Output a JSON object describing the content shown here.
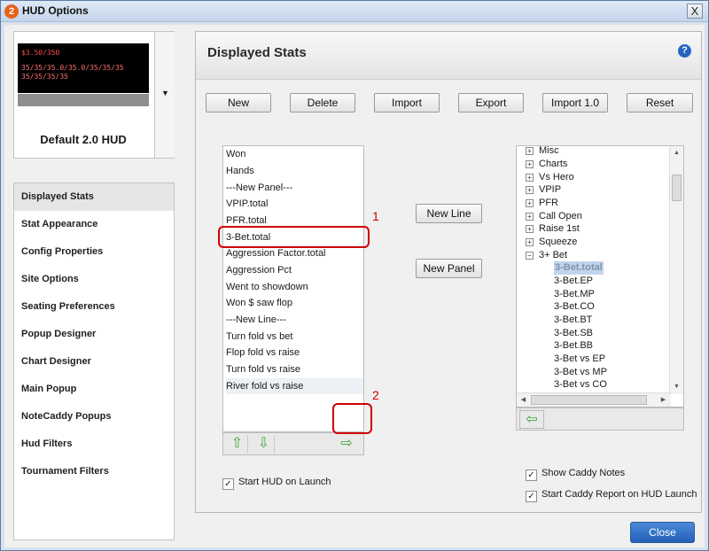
{
  "window": {
    "title": "HUD Options",
    "app_icon": "2",
    "close_glyph": "X"
  },
  "hud_preview": {
    "name": "Default 2.0 HUD",
    "line1": "$3.50/350",
    "line2": "35/35/35.0/35.0/35/35/35",
    "line3": "35/35/35/35",
    "dropdown_icon": "chevron-down-icon"
  },
  "sidebar": {
    "items": [
      {
        "label": "Displayed Stats",
        "active": true
      },
      {
        "label": "Stat Appearance"
      },
      {
        "label": "Config Properties"
      },
      {
        "label": "Site Options"
      },
      {
        "label": "Seating Preferences"
      },
      {
        "label": "Popup Designer"
      },
      {
        "label": "Chart Designer"
      },
      {
        "label": "Main Popup"
      },
      {
        "label": "NoteCaddy Popups"
      },
      {
        "label": "Hud Filters"
      },
      {
        "label": "Tournament Filters"
      }
    ]
  },
  "panel": {
    "title": "Displayed Stats",
    "help": "?"
  },
  "toolbar": {
    "new": "New",
    "delete": "Delete",
    "import": "Import",
    "export": "Export",
    "import10": "Import 1.0",
    "reset": "Reset"
  },
  "stats_list": [
    "Won",
    "Hands",
    "---New Panel---",
    "VPIP.total",
    "PFR.total",
    "3-Bet.total",
    "Aggression Factor.total",
    "Aggression Pct",
    "Went to showdown",
    "Won $ saw flop",
    "---New Line---",
    "Turn fold vs bet",
    "Flop fold vs raise",
    "Turn fold vs raise",
    "River fold vs raise"
  ],
  "mid_buttons": {
    "new_line": "New Line",
    "new_panel": "New Panel"
  },
  "tree": {
    "groups": [
      {
        "sign": "+",
        "label": "Misc"
      },
      {
        "sign": "+",
        "label": "Charts"
      },
      {
        "sign": "+",
        "label": "Vs Hero"
      },
      {
        "sign": "+",
        "label": "VPIP"
      },
      {
        "sign": "+",
        "label": "PFR"
      },
      {
        "sign": "+",
        "label": "Call Open"
      },
      {
        "sign": "+",
        "label": "Raise 1st"
      },
      {
        "sign": "+",
        "label": "Squeeze"
      },
      {
        "sign": "−",
        "label": "3+ Bet"
      }
    ],
    "leaves": [
      "3-Bet.total",
      "3-Bet.EP",
      "3-Bet.MP",
      "3-Bet.CO",
      "3-Bet.BT",
      "3-Bet.SB",
      "3-Bet.BB",
      "3-Bet vs EP",
      "3-Bet vs MP",
      "3-Bet vs CO"
    ]
  },
  "checkboxes": {
    "start_hud": "Start HUD on Launch",
    "show_caddy": "Show Caddy Notes",
    "start_caddy_report": "Start Caddy Report on HUD Launch",
    "mark": "✓"
  },
  "annotations": {
    "one": "1",
    "two": "2"
  },
  "close_button": "Close",
  "colors": {
    "annotation": "#d00000",
    "accent_blue": "#2360b8",
    "arrow_green": "#3fa33a"
  }
}
